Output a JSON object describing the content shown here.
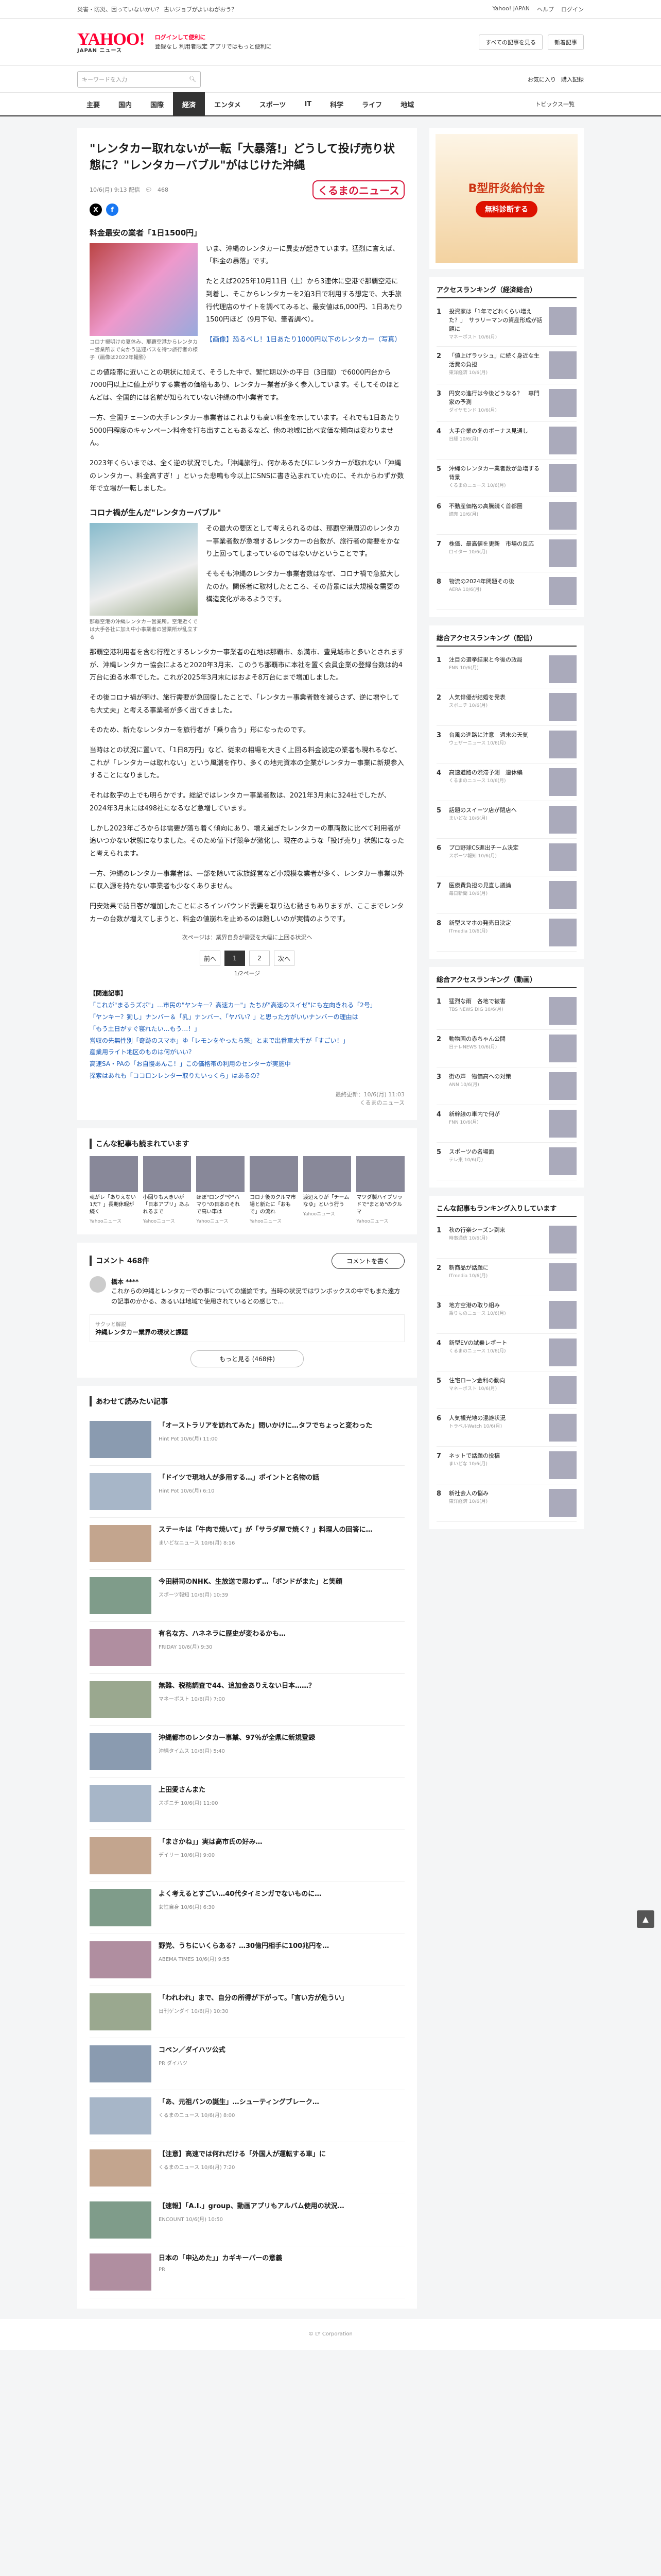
{
  "topbar": {
    "left": "災害・防災、困っていないかい？ 古いジョブがよいねがおう？",
    "links": [
      "Yahoo! JAPAN",
      "ヘルプ"
    ],
    "login": "ログイン"
  },
  "header": {
    "logo": "YAHOO!",
    "logo_sub": "JAPAN ニュース",
    "promo_line1": "ログインして便利に",
    "promo_line2": "登録なし 利用者限定 アプリではもっと便利に",
    "btn1": "すべての記事を見る",
    "btn2": "新着記事"
  },
  "search": {
    "placeholder": "キーワードを入力",
    "right1": "お気に入り",
    "right2": "購入記録"
  },
  "nav": [
    "主要",
    "国内",
    "国際",
    "経済",
    "エンタメ",
    "スポーツ",
    "IT",
    "科学",
    "ライフ",
    "地域"
  ],
  "nav_active": 3,
  "nav_right": "トピックス一覧",
  "article": {
    "title": "\"レンタカー取れないが一転「大暴落!」どうして投げ売り状態に？\"レンタカーバブル\"がはじけた沖縄",
    "date": "10/6(月) 9:13 配信",
    "comments": "468",
    "source_logo": "くるまのニュース",
    "h1": "料金最安の業者「1日1500円」",
    "fig1_cap": "コロナ禍明けの夏休み、那覇空港からレンタカー営業所まで向かう送迎バスを待つ旅行者の様子（画像は2022年撮影）",
    "p1": "いま、沖縄のレンタカーに異変が起きています。猛烈に言えば、「料金の暴落」です。",
    "p2": "たとえば2025年10月11日（土）から3連休に空港で那覇空港に到着し、そこからレンタカーを2泊3日で利用する想定で、大手旅行代理店のサイトを調べてみると、最安値は6,000円、1日あたり1500円ほど（9月下旬、筆者調べ）。",
    "p3": "【画像】恐るべし！1日あたり1000円以下のレンタカー（写真）",
    "p4": "この値段帯に近いことの現状に加えて、そうした中で、繁忙期以外の平日（3日間）で6000円台から7000円以上に値上がりする業者の価格もあり、レンタカー業者が多く参入しています。そしてそのほとんどは、全国的には名前が知られていない沖縄の中小業者です。",
    "p5": "一方、全国チェーンの大手レンタカー事業者はこれよりも高い料金を示しています。それでも1日あたり5000円程度のキャンペーン料金を打ち出すこともあるなど、他の地域に比べ安価な傾向は変わりません。",
    "p6": "2023年くらいまでは、全く逆の状況でした。「沖縄旅行」、何かあるたびにレンタカーが取れない「沖縄のレンタカー、料金高すぎ！」といった悲鳴も今以上にSNSに書き込まれていたのに、それからわずか数年で立場が一転しました。",
    "h2": "コロナ禍が生んだ\"レンタカーバブル\"",
    "fig2_cap": "那覇空港の沖縄レンタカー営業所。空港近くでは大手各社に加え中小事業者の営業所が乱立する",
    "p7": "その最大の要因として考えられるのは、那覇空港周辺のレンタカー事業者数が急増するレンタカーの台数が、旅行者の需要をかなり上回ってしまっているのではないかということです。",
    "p8": "そもそも沖縄のレンタカー事業者数はなぜ、コロナ禍で急拡大したのか。関係者に取材したところ、その背景には大規模な需要の構造変化があるようです。",
    "p9": "那覇空港利用者を含む行程とするレンタカー事業者の在地は那覇市、糸満市、豊見城市と多いとされますが、沖縄レンタカー協会によると2020年3月末、このうち那覇市に本社を置く会員企業の登録台数は約4万台に迫る水準でした。これが2025年3月末にはおよそ8万台にまで増加しました。",
    "p10": "その後コロナ禍が明け、旅行需要が急回復したことで、「レンタカー事業者数を減らさず、逆に増やしても大丈夫」と考える事業者が多く出てきました。",
    "p11": "そのため、新たなレンタカーを旅行者が「乗り合う」形になったのです。",
    "p12": "当時はとの状況に置いて、「1日8万円」など、従来の相場を大きく上回る料金設定の業者も現れるなど、これが「レンタカーは取れない」という風潮を作り、多くの地元資本の企業がレンタカー事業に新規参入することになりました。",
    "p13": "それは数字の上でも明らかです。総記ではレンタカー事業者数は、2021年3月末に324社でしたが、2024年3月末には498社になるなど急増しています。",
    "p14": "しかし2023年ごろからは需要が落ち着く傾向にあり、増え過ぎたレンタカーの車両数に比べて利用者が追いつかない状態になりました。そのため値下げ競争が激化し、現在のような「投げ売り」状態になったと考えられます。",
    "p15": "一方、沖縄のレンタカー事業者は、一部を除いて家族経営など小規模な業者が多く、レンタカー事業以外に収入源を持たない事業者も少なくありません。",
    "p16": "円安効果で訪日客が増加したことによるインバウンド需要を取り込む動きもありますが、ここまでレンタカーの台数が増えてしまうと、料金の値崩れを止めるのは難しいのが実情のようです。",
    "next_link": "次ページは：業界自身が需要を大幅に上回る状況へ",
    "pager_prev": "前へ",
    "pager_pages": [
      "1",
      "2"
    ],
    "pager_next": "次へ",
    "pager_info": "1/2ページ",
    "related_title": "【関連記事】",
    "related": [
      "「これが\"まるうズボ\"」…市民の\"ヤンキー？高速カー\"」たちが\"高速のスイゼ\"にも左向きれる「2号」",
      "「ヤンキー？狗し」ナンバー＆「乳」ナンバー、「ヤバい？」と思った方がいいナンバーの理由は",
      "「もう土日がすぐ寝れたい…もう…！」",
      "営収の先無性別「奇跡のスマホ」ゆ「レモンをやったら怒」とまで出番車大手が「すごい！」",
      "産業用ライト地区のものは何がいい？",
      "高速SA・PAの「お自慢あんこ！」この価格帯の利用のセンターが実施中",
      "探索はあれも「ココロンレンタ一取りたいっくら」はあるの？"
    ],
    "footer_meta": "最終更新：10/6(月) 11:03",
    "footer_src": "くるまのニュース"
  },
  "feature": {
    "title": "こんな記事も読まれています",
    "cards": [
      {
        "t": "魂がレ「ありえない1だ？」長期休暇が続く",
        "s": "Yahooニュース"
      },
      {
        "t": "小回りも大きいが「日本アプリ」あふれるまで",
        "s": "Yahooニュース"
      },
      {
        "t": "ほぼ\"ロング\"や\"ハマり\"の日本のそれで高い車は",
        "s": "Yahooニュース"
      },
      {
        "t": "コロナ後のクルマ市場と新たに「おもで」の流れ",
        "s": "Yahooニュース"
      },
      {
        "t": "渡辺えりが「チームなゆ」という行う",
        "s": "Yahooニュース"
      },
      {
        "t": "マツダ製ハイブリッドで\"まとめ\"のクルマ",
        "s": "Yahooニュース"
      }
    ]
  },
  "comments": {
    "title": "コメント 468件",
    "post_btn": "コメントを書く",
    "user": "橋本 ****",
    "text": "これからの沖縄とレンタカーでの事についての議論です。当時の状況ではワンボックスの中でもまた遠方の記事のかかる、あるいは地域で使用されているとの感じで…",
    "more_btn": "もっと見る (468件)",
    "quick_title": "沖縄レンタカー業界の現状と課題",
    "quick_sub": "サクッと解説"
  },
  "recommend": {
    "title": "あわせて読みたい記事",
    "items": [
      {
        "t": "「オーストラリアを訪れてみた」問いかけに…タフでちょっと変わった",
        "s": "Hint Pot 10/6(月) 11:00"
      },
      {
        "t": "「ドイツで現地人が多用する…」ポイントと名物の話",
        "s": "Hint Pot 10/6(月) 6:10"
      },
      {
        "t": "ステーキは「牛肉で焼いて」が「サラダ屋で焼く？」料理人の回答に…",
        "s": "まいどなニュース 10/6(月) 8:16"
      },
      {
        "t": "今田耕司のNHK、生放送で思わず…「ボンドがまた」と笑顔",
        "s": "スポーツ報知 10/6(月) 10:39"
      },
      {
        "t": "有名な方、ハネネラに歴史が変わるかも…",
        "s": "FRIDAY 10/6(月) 9:30"
      },
      {
        "t": "無難、税務調査で44、追加金ありえない日本……？",
        "s": "マネーポスト 10/6(月) 7:00"
      },
      {
        "t": "沖縄都市のレンタカー事業、97％が全県に新規登録",
        "s": "沖縄タイムス 10/6(月) 5:40"
      },
      {
        "t": "上田愛さんまた",
        "s": "スポニチ 10/6(月) 11:00"
      },
      {
        "t": "「まさかね」」実は高市氏の好み…",
        "s": "デイリー 10/6(月) 9:00"
      },
      {
        "t": "よく考えるとすごい…40代タイミンガでないものに…",
        "s": "女性自身 10/6(月) 6:30"
      },
      {
        "t": "野党、うちにいくらある？…30億円相手に100兆円を…",
        "s": "ABEMA TIMES 10/6(月) 9:55"
      },
      {
        "t": "「われわれ」まで、自分の所得が下がって。「言い方が危うい」",
        "s": "日刊ゲンダイ 10/6(月) 10:30"
      },
      {
        "t": "コペン／ダイハツ公式",
        "s": "PR ダイハツ"
      },
      {
        "t": "「あ、元祖バンの誕生」…シューティングブレーク…",
        "s": "くるまのニュース 10/6(月) 8:00"
      },
      {
        "t": "【注意】高速では何れだける「外国人が運転する車」に",
        "s": "くるまのニュース 10/6(月) 7:20"
      },
      {
        "t": "【速報】「A.I.」group、動画アプリもアルバム使用の状況…",
        "s": "ENCOUNT 10/6(月) 10:50"
      },
      {
        "t": "日本の「申込めた」」カギキーパーの意義",
        "s": "PR"
      }
    ]
  },
  "side_ad": {
    "title": "B型肝炎給付金",
    "cta": "無料診断する"
  },
  "side_rank1": {
    "title": "アクセスランキング（経済総合）",
    "items": [
      {
        "t": "投資家は「1年でどれくらい増えた？」　サラリーマンの資産形成が話題に",
        "s": "マネーポスト 10/6(月)"
      },
      {
        "t": "「値上げラッシュ」に続く身近な生活費の負担",
        "s": "東洋経済 10/6(月)"
      },
      {
        "t": "円安の進行は今後どうなる？　専門家の予測",
        "s": "ダイヤモンド 10/6(月)"
      },
      {
        "t": "大手企業の冬のボーナス見通し",
        "s": "日経 10/6(月)"
      },
      {
        "t": "沖縄のレンタカー業者数が急増する背景",
        "s": "くるまのニュース 10/6(月)"
      },
      {
        "t": "不動産価格の高騰続く首都圏",
        "s": "読売 10/6(月)"
      },
      {
        "t": "株価、最高値を更新　市場の反応",
        "s": "ロイター 10/6(月)"
      },
      {
        "t": "物流の2024年問題その後",
        "s": "AERA 10/6(月)"
      }
    ]
  },
  "side_rank2": {
    "title": "総合アクセスランキング（配信）",
    "items": [
      {
        "t": "注目の選挙結果と今後の政局",
        "s": "FNN 10/6(月)"
      },
      {
        "t": "人気俳優が結婚を発表",
        "s": "スポニチ 10/6(月)"
      },
      {
        "t": "台風の進路に注意　週末の天気",
        "s": "ウェザーニュース 10/6(月)"
      },
      {
        "t": "高速道路の渋滞予測　連休編",
        "s": "くるまのニュース 10/6(月)"
      },
      {
        "t": "話題のスイーツ店が閉店へ",
        "s": "まいどな 10/6(月)"
      },
      {
        "t": "プロ野球CS進出チーム決定",
        "s": "スポーツ報知 10/6(月)"
      },
      {
        "t": "医療費負担の見直し議論",
        "s": "毎日新聞 10/6(月)"
      },
      {
        "t": "新型スマホの発売日決定",
        "s": "ITmedia 10/6(月)"
      }
    ]
  },
  "side_rank3": {
    "title": "総合アクセスランキング（動画）",
    "items": [
      {
        "t": "猛烈な雨　各地で被害",
        "s": "TBS NEWS DIG 10/6(月)"
      },
      {
        "t": "動物園の赤ちゃん公開",
        "s": "日テレNEWS 10/6(月)"
      },
      {
        "t": "街の声　物価高への対策",
        "s": "ANN 10/6(月)"
      },
      {
        "t": "新幹線の車内で何が",
        "s": "FNN 10/6(月)"
      },
      {
        "t": "スポーツの名場面",
        "s": "テレ東 10/6(月)"
      }
    ]
  },
  "side_rank4": {
    "title": "こんな記事もランキング入りしています",
    "items": [
      {
        "t": "秋の行楽シーズン到来",
        "s": "時事通信 10/6(月)"
      },
      {
        "t": "新商品が話題に",
        "s": "ITmedia 10/6(月)"
      },
      {
        "t": "地方空港の取り組み",
        "s": "乗りものニュース 10/6(月)"
      },
      {
        "t": "新型EVの試乗レポート",
        "s": "くるまのニュース 10/6(月)"
      },
      {
        "t": "住宅ローン金利の動向",
        "s": "マネーポスト 10/6(月)"
      },
      {
        "t": "人気観光地の混雑状況",
        "s": "トラベルWatch 10/6(月)"
      },
      {
        "t": "ネットで話題の投稿",
        "s": "まいどな 10/6(月)"
      },
      {
        "t": "新社会人の悩み",
        "s": "東洋経済 10/6(月)"
      }
    ]
  },
  "pagetop": "▲",
  "footer": "© LY Corporation"
}
